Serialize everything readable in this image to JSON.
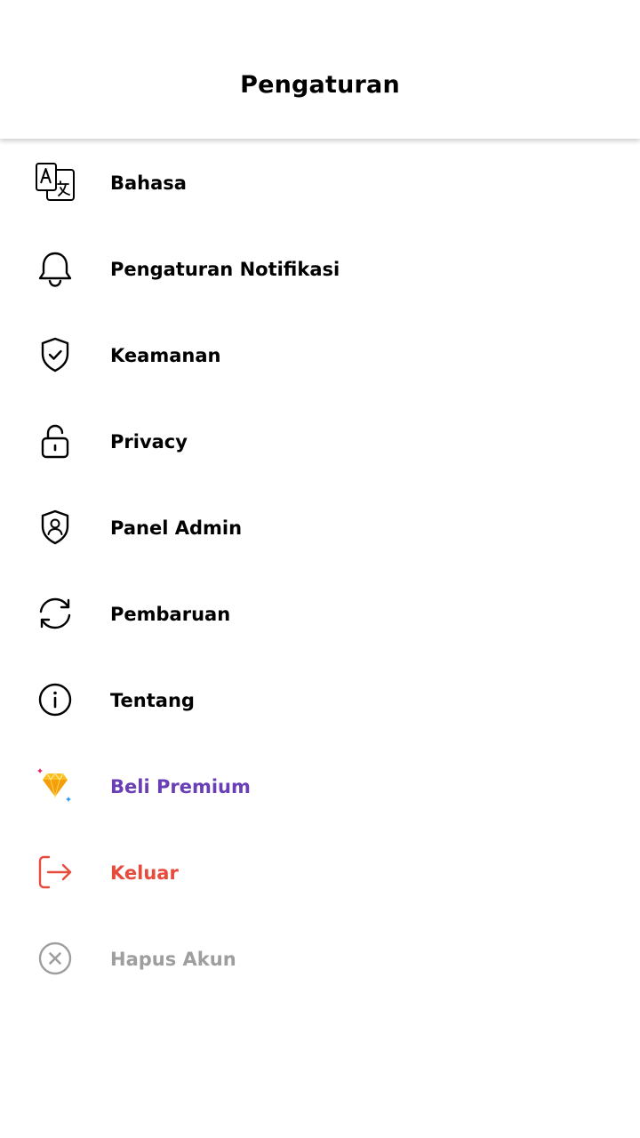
{
  "app": {
    "accent": "#1de9b6"
  },
  "header": {
    "title": "Pengaturan"
  },
  "menu": {
    "items": [
      {
        "label": "Bahasa",
        "icon": "translate-icon"
      },
      {
        "label": "Pengaturan Notifikasi",
        "icon": "bell-icon"
      },
      {
        "label": "Keamanan",
        "icon": "shield-check-icon"
      },
      {
        "label": "Privacy",
        "icon": "unlock-icon"
      },
      {
        "label": "Panel Admin",
        "icon": "shield-user-icon"
      },
      {
        "label": "Pembaruan",
        "icon": "refresh-icon"
      },
      {
        "label": "Tentang",
        "icon": "info-icon"
      },
      {
        "label": "Beli Premium",
        "icon": "diamond-icon",
        "color": "#6a3fb5"
      },
      {
        "label": "Keluar",
        "icon": "logout-icon",
        "color": "#e74b3c"
      },
      {
        "label": "Hapus Akun",
        "icon": "close-circle-icon",
        "color": "#9e9e9e"
      }
    ]
  }
}
